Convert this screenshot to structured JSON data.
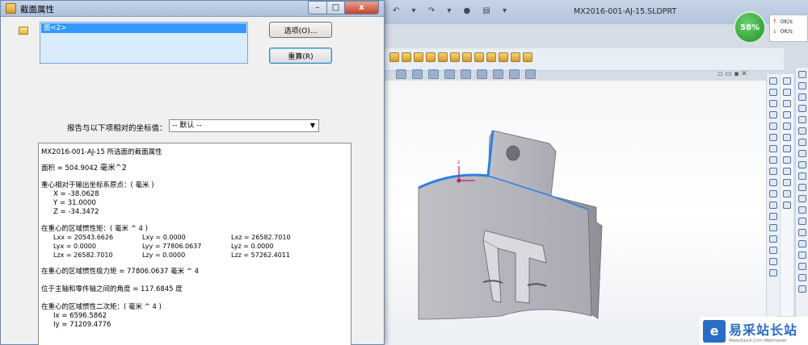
{
  "dialog": {
    "title": "截面属性",
    "window_controls": {
      "minimize": "–",
      "maximize": "□",
      "close": "x"
    },
    "selection_item": "面<2>",
    "options_button": "选项(O)...",
    "recalc_button": "重算(R)",
    "coord_label": "报告与以下项相对的坐标值：",
    "coord_value": "-- 默认 --",
    "results": {
      "header": "MX2016-001-AJ-15 所选面的截面属性",
      "area_label": "面积 = 504.9042",
      "area_unit": "毫米^2",
      "centroid_label": "重心相对于输出坐标系原点：( 毫米 )",
      "cx": "X = -38.0628",
      "cy": "Y = 31.0000",
      "cz": "Z = -34.3472",
      "moi_label": "在重心的区域惯性矩：( 毫米 ^ 4 )",
      "lxx": "Lxx = 20543.6626",
      "lxy": "Lxy = 0.0000",
      "lxz": "Lxz = 26582.7010",
      "lyx": "Lyx = 0.0000",
      "lyy": "Lyy = 77806.0637",
      "lyz": "Lyz = 0.0000",
      "lzx": "Lzx = 26582.7010",
      "lzy": "Lzy = 0.0000",
      "lzz": "Lzz = 57262.4011",
      "polar_label": "在重心的区域惯性极力矩 = 77806.0637",
      "polar_unit": "毫米 ^ 4",
      "angle_label": "位于主轴和零件轴之间的角度 = 117.6845",
      "angle_unit": "度",
      "second_moment_label": "在重心的区域惯性二次矩：( 毫米 ^ 4 )",
      "ix": "Ix = 6596.5862",
      "iy": "Iy = 71209.4776"
    }
  },
  "cad": {
    "document_title": "MX2016-001-AJ-15.SLDPRT",
    "qat_icons": "↶ ▾ ↷ ▾ ● ▤ ▾",
    "net_percent": "58%",
    "net_up": "0K/s",
    "net_down": "0K/s",
    "win_mini": "▫ ▭ ▪ ✕"
  },
  "watermark": {
    "logo": "e",
    "name": "易采站长站",
    "url": "Www.Easck.Com  Webmaster"
  }
}
